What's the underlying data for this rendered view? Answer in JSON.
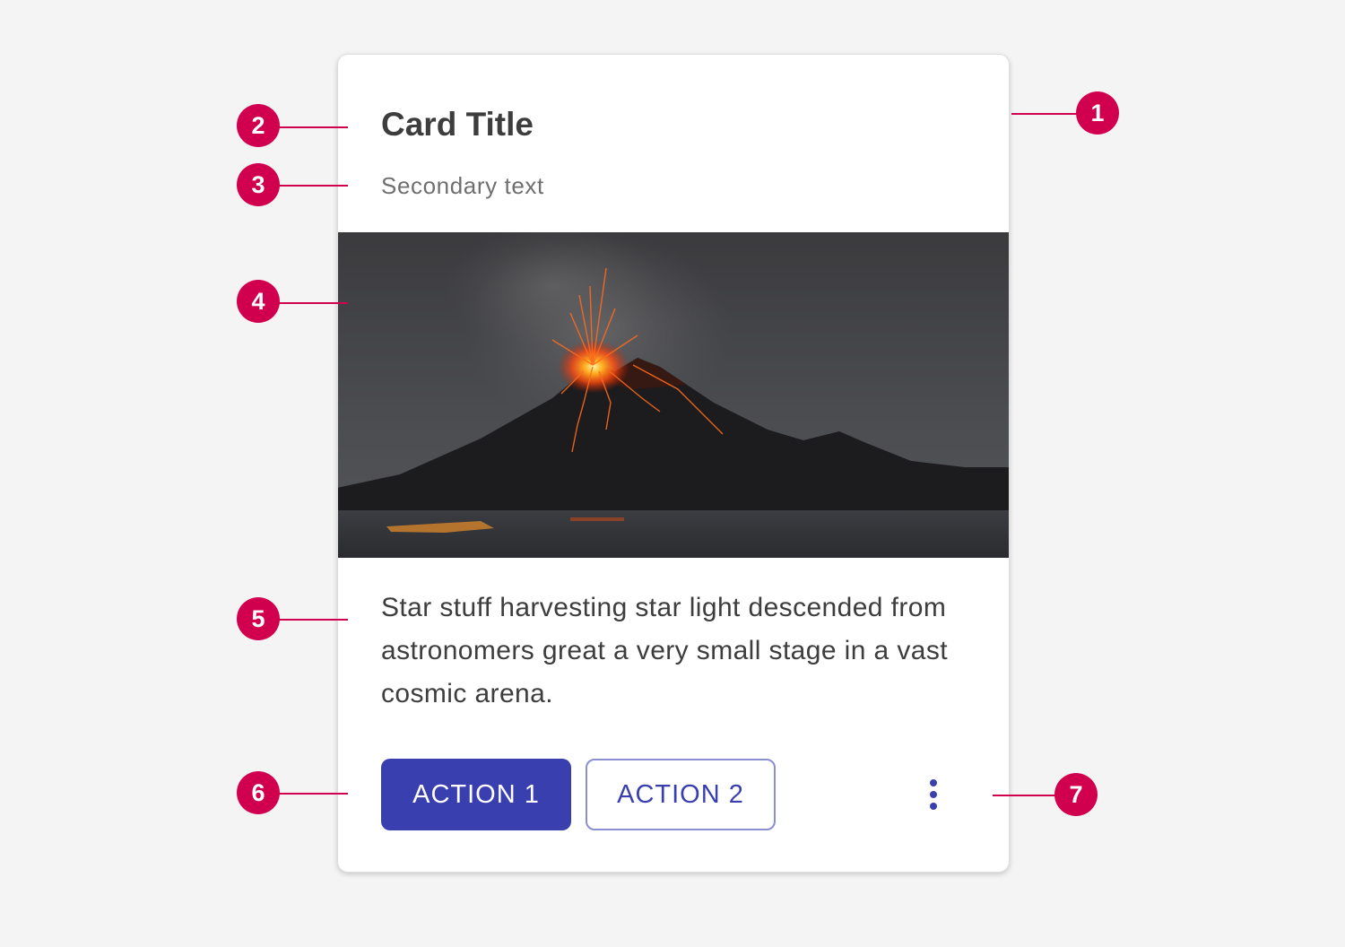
{
  "card": {
    "title": "Card Title",
    "secondary_text": "Secondary text",
    "media": "volcano-eruption-photo",
    "body_text": "Star stuff harvesting star light descended from astronomers great a very small stage in a vast cosmic arena.",
    "actions": {
      "primary_label": "ACTION 1",
      "secondary_label": "ACTION 2",
      "overflow_icon": "more-vertical-icon"
    }
  },
  "callouts": {
    "1": "1",
    "2": "2",
    "3": "3",
    "4": "4",
    "5": "5",
    "6": "6",
    "7": "7"
  },
  "colors": {
    "page_background": "#f4f4f4",
    "card_background": "#ffffff",
    "primary_action": "#3a3fb0",
    "callout": "#d1004f",
    "title_text": "#3d3d3d",
    "secondary_text": "#6f6f6f"
  }
}
